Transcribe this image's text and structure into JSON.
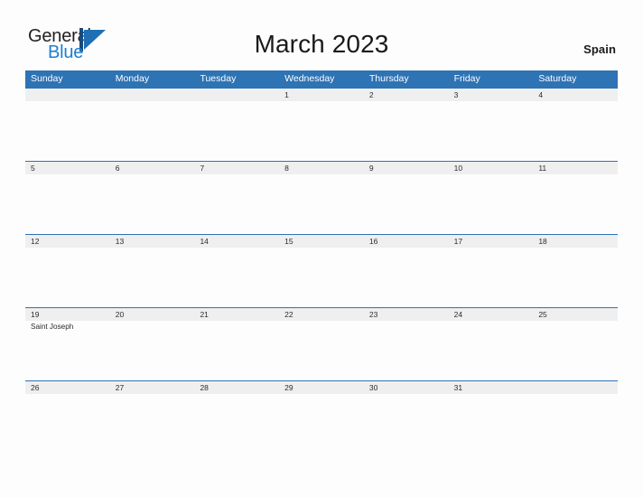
{
  "brand": {
    "word_one": "General",
    "word_two": "Blue",
    "mark_icon": "general-blue-triangle-logo"
  },
  "header": {
    "title": "March 2023",
    "country": "Spain"
  },
  "theme": {
    "header_blue": "#2e73b4",
    "band_gray": "#efefef",
    "logo_blue": "#1b7fd4",
    "text_dark": "#1a1a1a",
    "page_background": "#fdfdfd"
  },
  "calendar": {
    "month": "March",
    "year": "2023",
    "weekdays": [
      "Sunday",
      "Monday",
      "Tuesday",
      "Wednesday",
      "Thursday",
      "Friday",
      "Saturday"
    ],
    "weeks": [
      {
        "days": [
          {
            "num": "",
            "events": []
          },
          {
            "num": "",
            "events": []
          },
          {
            "num": "",
            "events": []
          },
          {
            "num": "1",
            "events": []
          },
          {
            "num": "2",
            "events": []
          },
          {
            "num": "3",
            "events": []
          },
          {
            "num": "4",
            "events": []
          }
        ]
      },
      {
        "days": [
          {
            "num": "5",
            "events": []
          },
          {
            "num": "6",
            "events": []
          },
          {
            "num": "7",
            "events": []
          },
          {
            "num": "8",
            "events": []
          },
          {
            "num": "9",
            "events": []
          },
          {
            "num": "10",
            "events": []
          },
          {
            "num": "11",
            "events": []
          }
        ]
      },
      {
        "days": [
          {
            "num": "12",
            "events": []
          },
          {
            "num": "13",
            "events": []
          },
          {
            "num": "14",
            "events": []
          },
          {
            "num": "15",
            "events": []
          },
          {
            "num": "16",
            "events": []
          },
          {
            "num": "17",
            "events": []
          },
          {
            "num": "18",
            "events": []
          }
        ]
      },
      {
        "days": [
          {
            "num": "19",
            "events": [
              "Saint Joseph"
            ]
          },
          {
            "num": "20",
            "events": []
          },
          {
            "num": "21",
            "events": []
          },
          {
            "num": "22",
            "events": []
          },
          {
            "num": "23",
            "events": []
          },
          {
            "num": "24",
            "events": []
          },
          {
            "num": "25",
            "events": []
          }
        ]
      },
      {
        "days": [
          {
            "num": "26",
            "events": []
          },
          {
            "num": "27",
            "events": []
          },
          {
            "num": "28",
            "events": []
          },
          {
            "num": "29",
            "events": []
          },
          {
            "num": "30",
            "events": []
          },
          {
            "num": "31",
            "events": []
          },
          {
            "num": "",
            "events": []
          }
        ]
      }
    ]
  }
}
